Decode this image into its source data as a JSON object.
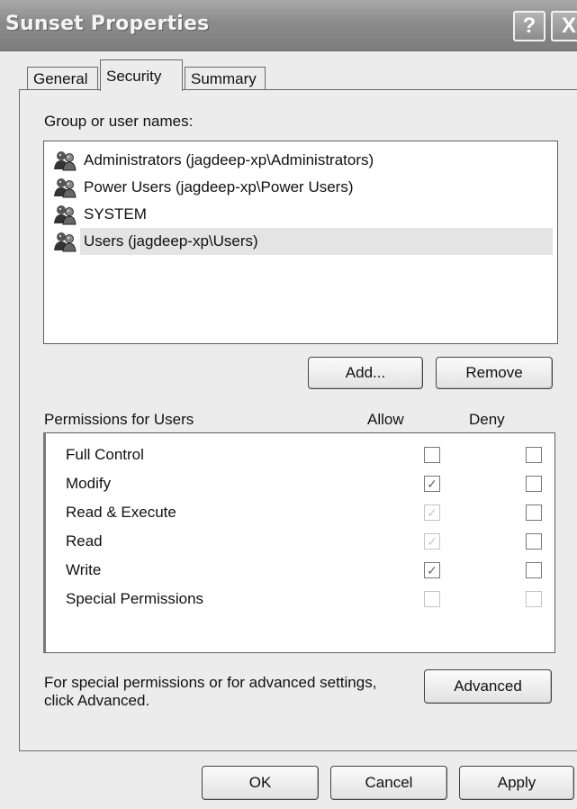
{
  "window": {
    "title": "Sunset Properties",
    "help_label": "?",
    "close_label": "X"
  },
  "tabs": [
    {
      "label": "General",
      "active": false
    },
    {
      "label": "Security",
      "active": true
    },
    {
      "label": "Summary",
      "active": false
    }
  ],
  "groups": {
    "label": "Group or user names:",
    "items": [
      {
        "name": "Administrators (jagdeep-xp\\Administrators)",
        "icon": "users-group-icon",
        "selected": false
      },
      {
        "name": "Power Users (jagdeep-xp\\Power Users)",
        "icon": "users-group-icon",
        "selected": false
      },
      {
        "name": "SYSTEM",
        "icon": "users-group-icon",
        "selected": false
      },
      {
        "name": "Users (jagdeep-xp\\Users)",
        "icon": "users-group-icon",
        "selected": true
      }
    ],
    "add_label": "Add...",
    "remove_label": "Remove"
  },
  "permissions": {
    "header": "Permissions for Users",
    "allow_header": "Allow",
    "deny_header": "Deny",
    "rows": [
      {
        "name": "Full Control",
        "allow": "unchecked",
        "deny": "unchecked"
      },
      {
        "name": "Modify",
        "allow": "checked",
        "deny": "unchecked"
      },
      {
        "name": "Read & Execute",
        "allow": "checked-disabled",
        "deny": "unchecked"
      },
      {
        "name": "Read",
        "allow": "checked-disabled",
        "deny": "unchecked"
      },
      {
        "name": "Write",
        "allow": "checked",
        "deny": "unchecked"
      },
      {
        "name": "Special Permissions",
        "allow": "unchecked-disabled",
        "deny": "unchecked-disabled"
      }
    ]
  },
  "advanced": {
    "text_line1": "For special permissions or for advanced settings,",
    "text_line2": "click Advanced.",
    "button_label": "Advanced"
  },
  "footer": {
    "ok_label": "OK",
    "cancel_label": "Cancel",
    "apply_label": "Apply"
  },
  "colors": {
    "titlebar": "#8b8b8b",
    "dialog_bg": "#ececec",
    "selection": "#e4e4e4"
  }
}
